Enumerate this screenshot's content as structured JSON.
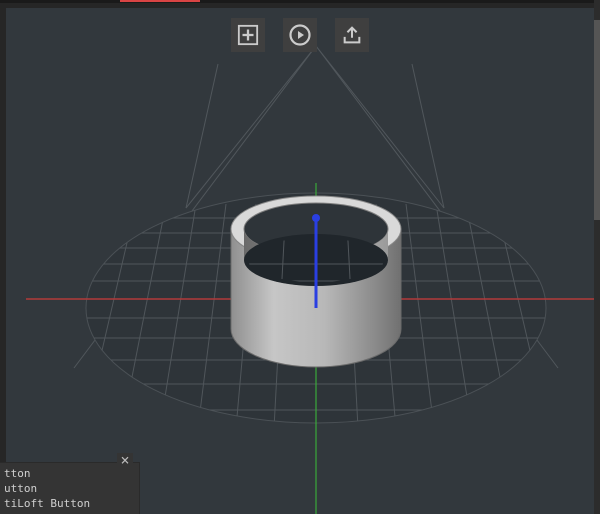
{
  "toolbar": {
    "add": {
      "name": "add-preset-button",
      "icon": "plus-icon"
    },
    "play": {
      "name": "play-button",
      "icon": "play-circle-icon"
    },
    "export": {
      "name": "export-button",
      "icon": "upload-icon"
    }
  },
  "scene": {
    "object": "hollow-cylinder",
    "axes": {
      "x_color": "#a83a3a",
      "y_color": "#3aa83a",
      "z_color": "#3a4ae0"
    },
    "ground": "circular-grid",
    "camera_guides": true
  },
  "log": {
    "lines": [
      "tton",
      "utton",
      "tiLoft Button"
    ]
  },
  "colors": {
    "viewport_bg": "#32383d",
    "toolbar_btn": "#3f3f3f",
    "icon": "#cbcbcb",
    "panel": "#343434"
  }
}
